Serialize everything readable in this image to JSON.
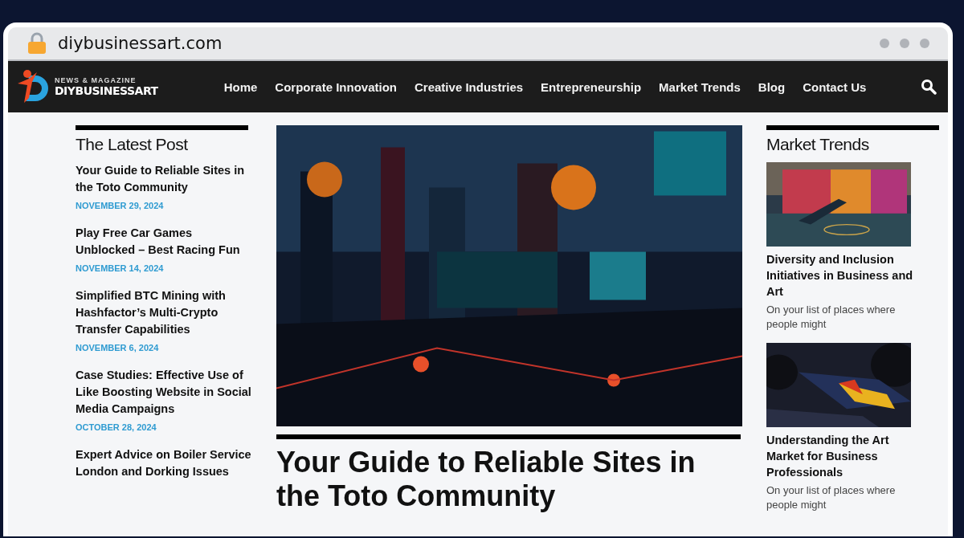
{
  "browser": {
    "url": "diybusinessart.com"
  },
  "site": {
    "logo_tagline": "NEWS & MAGAZINE",
    "logo_name": "DIYBUSINESSART"
  },
  "nav": [
    {
      "label": "Home"
    },
    {
      "label": "Corporate Innovation"
    },
    {
      "label": "Creative Industries"
    },
    {
      "label": "Entrepreneurship"
    },
    {
      "label": "Market Trends"
    },
    {
      "label": "Blog"
    },
    {
      "label": "Contact Us"
    }
  ],
  "latest": {
    "heading": "The Latest Post",
    "posts": [
      {
        "title": "Your Guide to Reliable Sites in the Toto Community",
        "date": "NOVEMBER 29, 2024"
      },
      {
        "title": "Play Free Car Games Unblocked – Best Racing Fun",
        "date": "NOVEMBER 14, 2024"
      },
      {
        "title": "Simplified BTC Mining with Hashfactor’s Multi-Crypto Transfer Capabilities",
        "date": "NOVEMBER 6, 2024"
      },
      {
        "title": "Case Studies: Effective Use of Like Boosting Website in Social Media Campaigns",
        "date": "OCTOBER 28, 2024"
      },
      {
        "title": "Expert Advice on Boiler Service London and Dorking Issues"
      }
    ]
  },
  "feature": {
    "title": "Your Guide to Reliable Sites in the Toto Community"
  },
  "trends": {
    "heading": "Market Trends",
    "posts": [
      {
        "title": "Diversity and Inclusion Initiatives in Business and Art",
        "excerpt": "On your list of places where people might"
      },
      {
        "title": "Understanding the Art Market for Business Professionals",
        "excerpt": "On your list of places where people might"
      }
    ]
  }
}
